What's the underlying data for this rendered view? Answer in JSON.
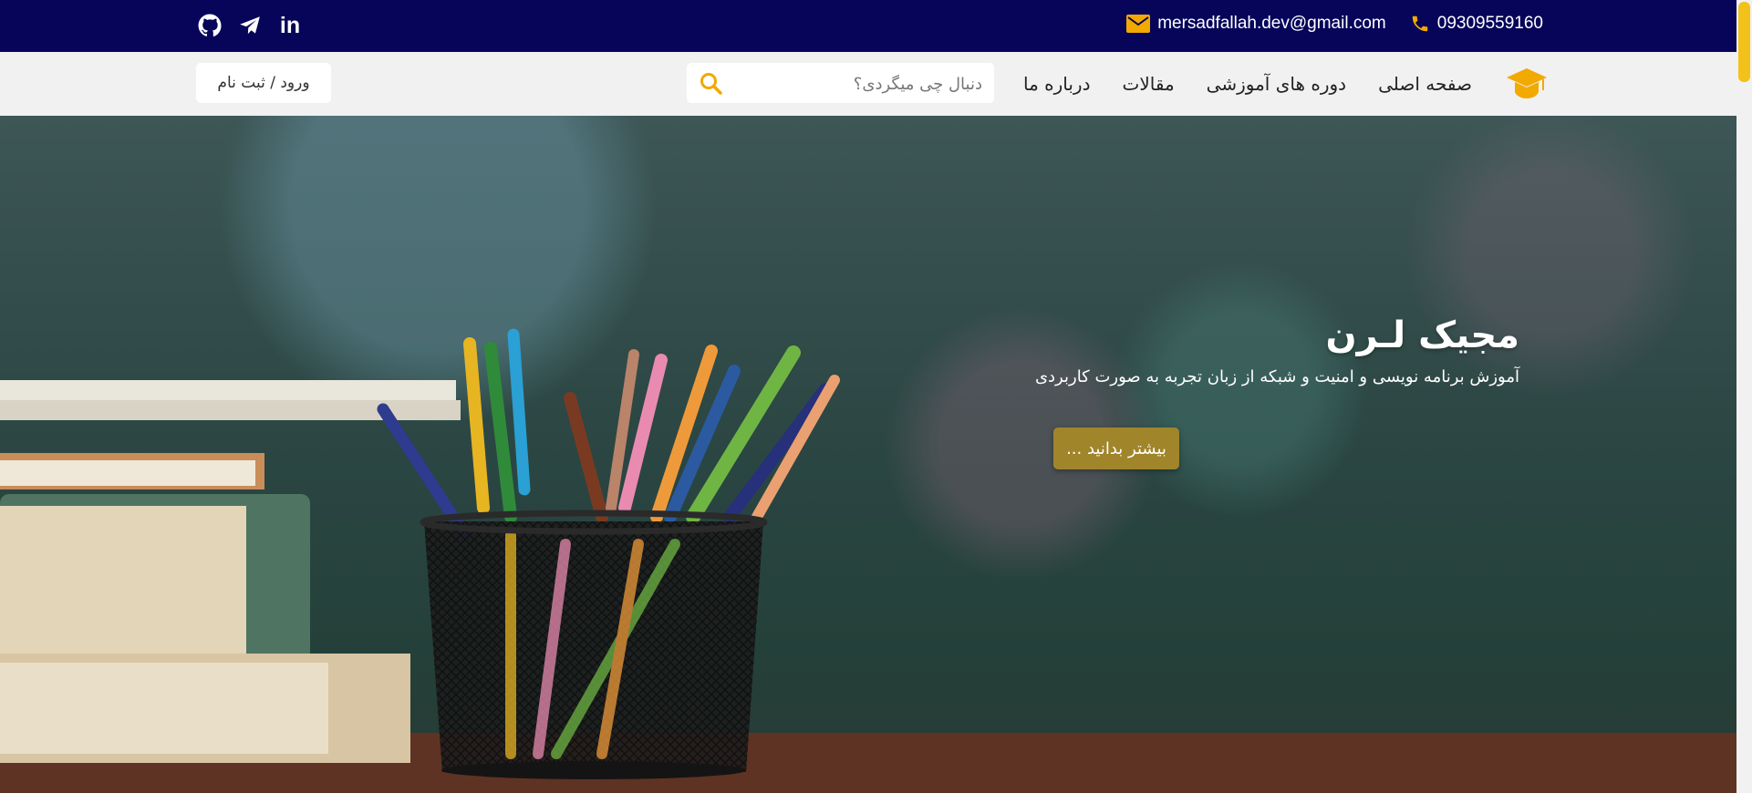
{
  "topbar": {
    "phone": "09309559160",
    "email": "mersadfallah.dev@gmail.com",
    "social_icons": [
      "github-icon",
      "telegram-icon",
      "linkedin-icon"
    ],
    "linkedin_text": "in"
  },
  "navbar": {
    "logo_icon": "graduation-cap-icon",
    "menu": {
      "home": "صفحه اصلی",
      "courses": "دوره های آموزشی",
      "articles": "مقالات",
      "about": "درباره ما"
    },
    "search": {
      "placeholder": "دنبال چی میگردی؟"
    },
    "login_label": "ورود / ثبت نام"
  },
  "hero": {
    "title": "مجیک لـرن",
    "subtitle": "آموزش برنامه نویسی و امنیت و شبکه از زبان تجربه به صورت کاربردی",
    "button_label": "بیشتر بدانید ..."
  },
  "colors": {
    "topbar_bg": "#06055a",
    "accent": "#f2a900",
    "button_gold": "#a0852a",
    "navbar_bg": "#f1f1f1"
  }
}
